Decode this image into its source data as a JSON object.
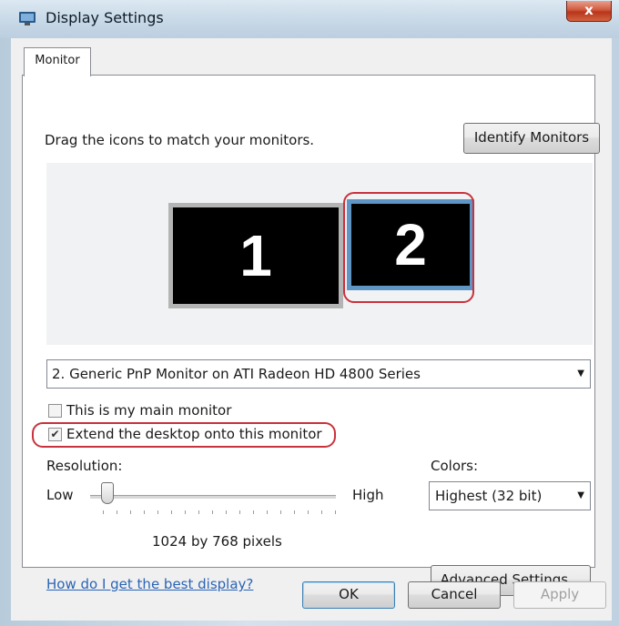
{
  "window": {
    "title": "Display Settings",
    "close_symbol": "x"
  },
  "tabs": [
    {
      "label": "Monitor"
    }
  ],
  "monitor_tab": {
    "instruction": "Drag the icons to match your monitors.",
    "identify_button": "Identify Monitors",
    "monitors": [
      {
        "number": "1"
      },
      {
        "number": "2"
      }
    ],
    "monitor_select": {
      "value": "2. Generic PnP Monitor on ATI Radeon HD 4800 Series"
    },
    "main_monitor_checkbox": {
      "label": "This is my main monitor",
      "checked": false
    },
    "extend_checkbox": {
      "label": "Extend the desktop onto this monitor",
      "checked": true
    },
    "resolution": {
      "label": "Resolution:",
      "low_label": "Low",
      "high_label": "High",
      "value_text": "1024 by 768 pixels",
      "slider_fraction": 0.05
    },
    "colors": {
      "label": "Colors:",
      "value": "Highest (32 bit)"
    },
    "help_link": "How do I get the best display?",
    "advanced_button": "Advanced Settings..."
  },
  "dialog_buttons": {
    "ok": "OK",
    "cancel": "Cancel",
    "apply": "Apply"
  },
  "colors_meta": {
    "selected_monitor_border": "#5e95c5",
    "highlight_ring": "#c8323c",
    "link": "#2a64b6"
  }
}
